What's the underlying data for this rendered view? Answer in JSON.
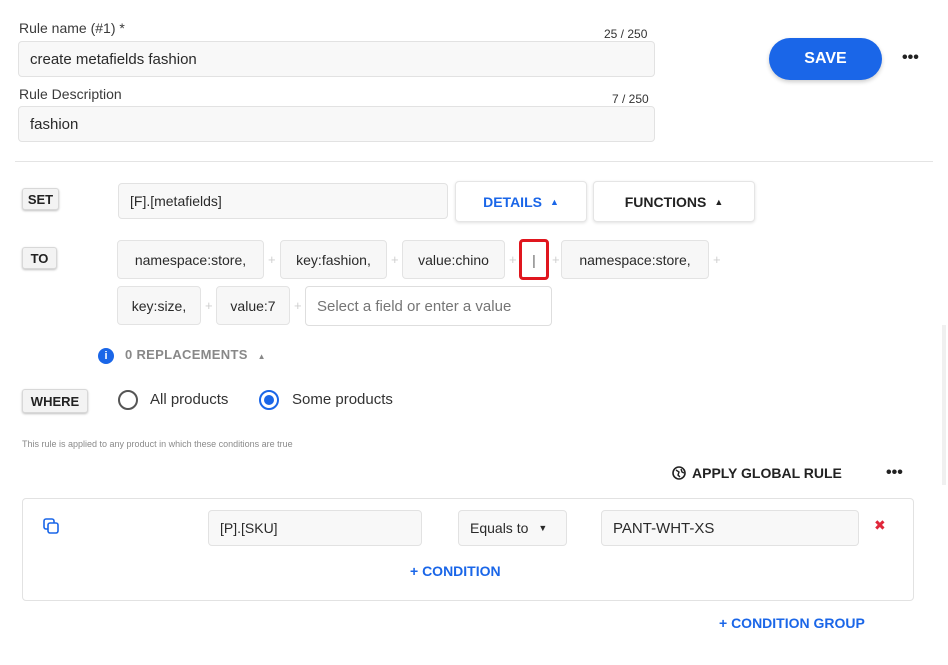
{
  "rule_name": {
    "label": "Rule name (#1) *",
    "counter": "25 / 250",
    "value": "create metafields fashion"
  },
  "rule_description": {
    "label": "Rule Description",
    "counter": "7 / 250",
    "value": "fashion"
  },
  "toolbar": {
    "save_label": "SAVE",
    "more_label": "•••"
  },
  "set": {
    "tag": "SET",
    "field": "[F].[metafields]",
    "details_label": "DETAILS",
    "functions_label": "FUNCTIONS",
    "caret": "▲"
  },
  "to": {
    "tag": "TO",
    "chips": [
      "namespace:store,",
      "key:fashion,",
      "value:chino",
      "|",
      "namespace:store,",
      "key:size,",
      "value:7"
    ],
    "input_placeholder": "Select a field or enter a value",
    "plus": "+"
  },
  "replacements": {
    "label": "0 REPLACEMENTS",
    "caret": "▲",
    "info": "i"
  },
  "where": {
    "tag": "WHERE",
    "options": [
      "All products",
      "Some products"
    ],
    "selected": "Some products",
    "helper": "This rule is applied to any product in which these conditions are true"
  },
  "global": {
    "label": "APPLY GLOBAL RULE",
    "more_label": "•••"
  },
  "condition": {
    "field": "[P].[SKU]",
    "operator": "Equals to",
    "operator_caret": "▼",
    "value": "PANT-WHT-XS",
    "remove": "✖",
    "add_condition": "+ CONDITION",
    "add_group": "+ CONDITION GROUP"
  },
  "colors": {
    "accent": "#1a66e8",
    "danger": "#e0273a",
    "highlight": "#e0161e"
  }
}
